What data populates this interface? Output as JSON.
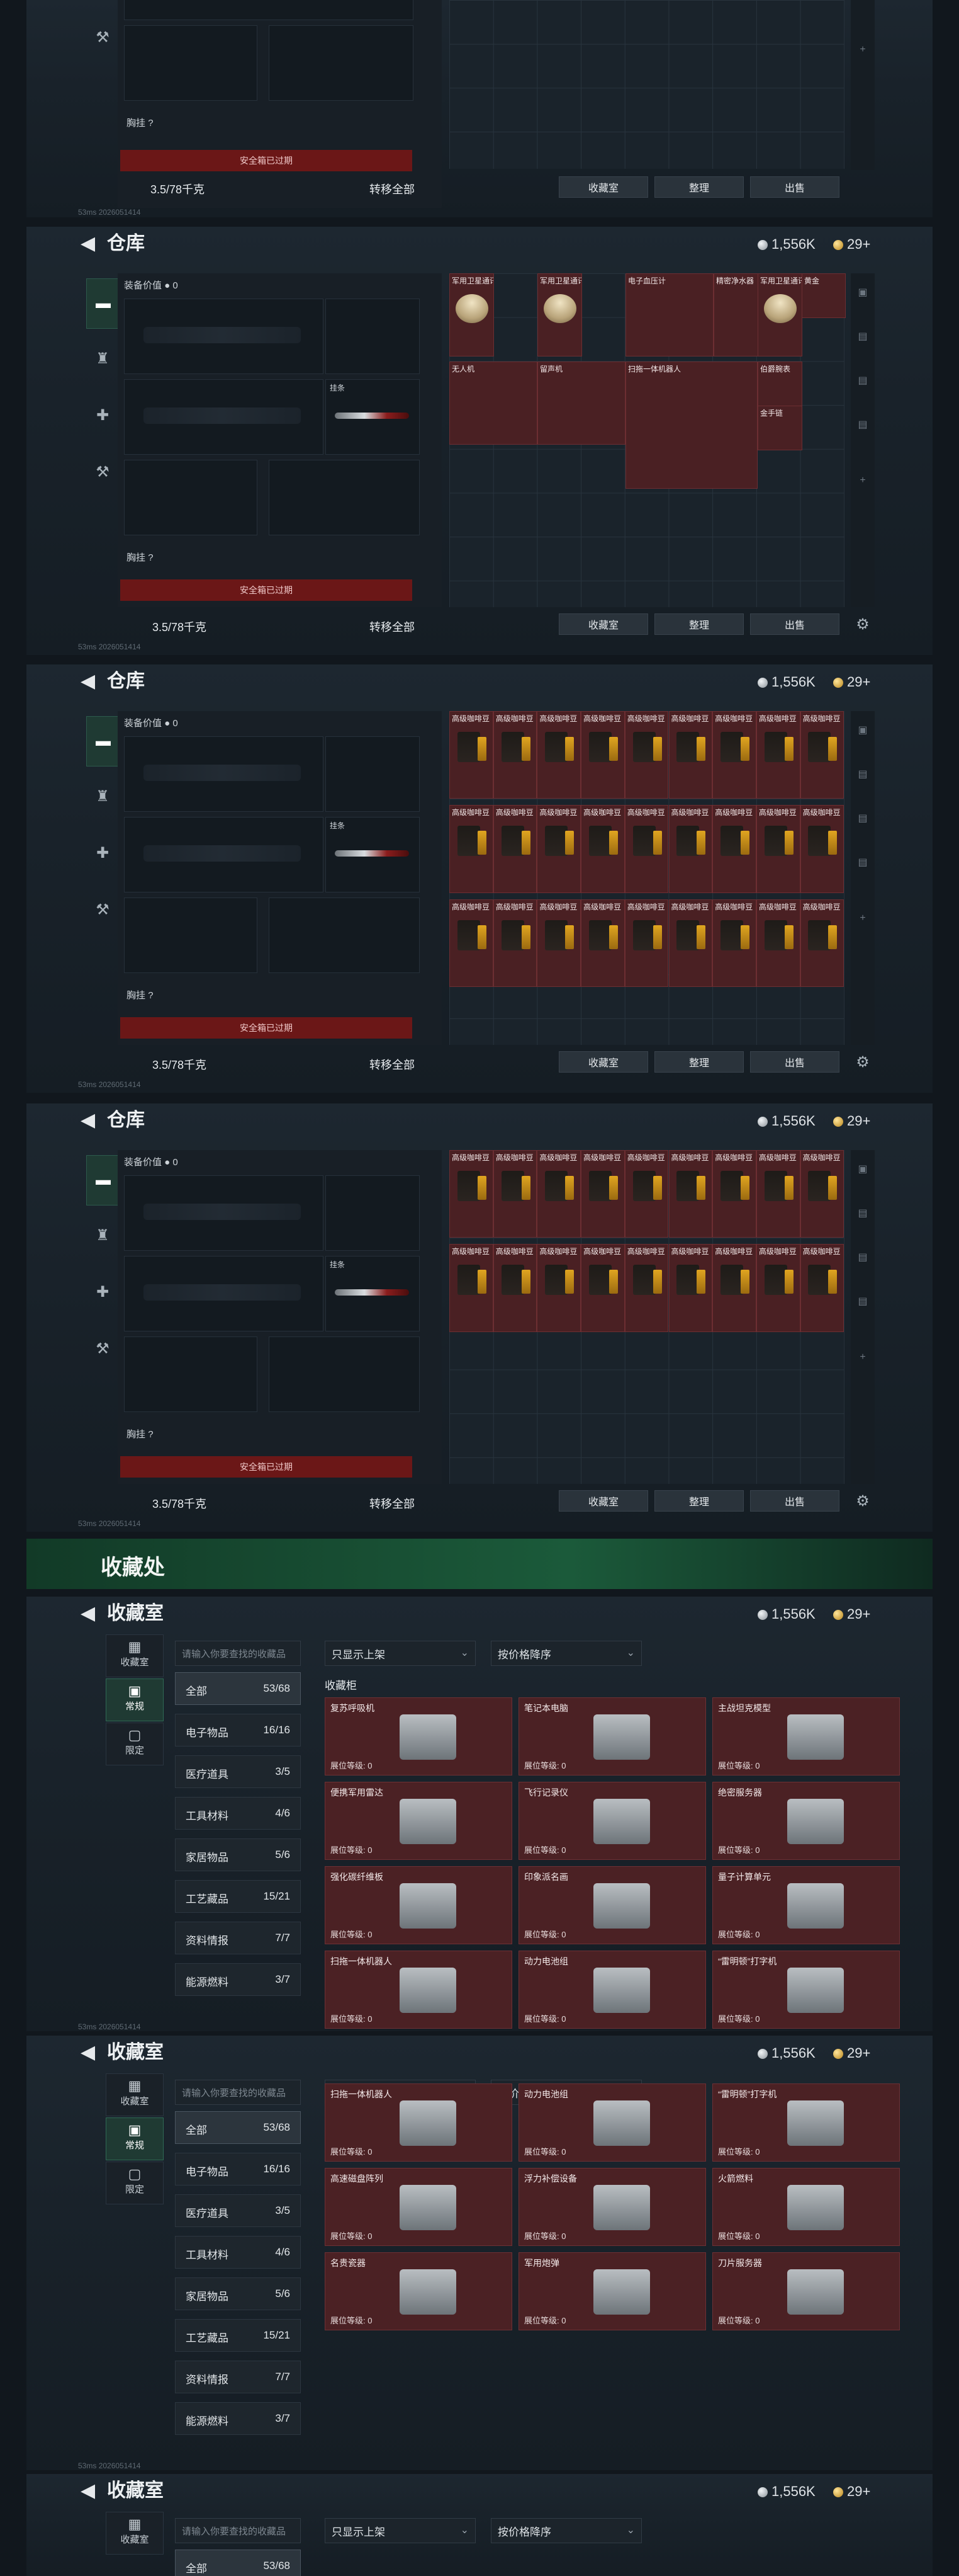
{
  "warehouse": {
    "title": "仓库",
    "equip_value_label": "装备价值",
    "equip_value": "0",
    "chest_label": "胸挂",
    "chest_q": "?",
    "expired_text": "安全箱已过期",
    "capacity": "3.5/78千克",
    "transfer_label": "转移全部",
    "sling_label": "挂条",
    "buttons": {
      "collection": "收藏室",
      "organize": "整理",
      "sell": "出售"
    },
    "currency_silver": "1,556K",
    "currency_gold": "29+",
    "status_ping": "53ms",
    "status_id": "2026051414"
  },
  "items_panel2": [
    "军用卫星通讯仪",
    "军用卫星通讯仪",
    "电子血压计",
    "精密净水器",
    "军用卫星通讯仪",
    "黄金",
    "无人机",
    "留声机",
    "扫拖一体机器人",
    "伯爵腕表",
    "金手链"
  ],
  "coffee_label": "高级咖啡豆",
  "collection_banner": "收藏处",
  "collection": {
    "title": "收藏室",
    "tabs": [
      "收藏室",
      "常规",
      "限定"
    ],
    "search_placeholder": "请输入你要查找的收藏品",
    "filter": "只显示上架",
    "sort": "按价格降序",
    "section": "收藏柜",
    "categories": [
      {
        "name": "全部",
        "count": "53/68"
      },
      {
        "name": "电子物品",
        "count": "16/16"
      },
      {
        "name": "医疗道具",
        "count": "3/5"
      },
      {
        "name": "工具材料",
        "count": "4/6"
      },
      {
        "name": "家居物品",
        "count": "5/6"
      },
      {
        "name": "工艺藏品",
        "count": "15/21"
      },
      {
        "name": "资料情报",
        "count": "7/7"
      },
      {
        "name": "能源燃料",
        "count": "3/7"
      }
    ],
    "level_label": "展位等级: 0",
    "cards_a": [
      "复苏呼吸机",
      "笔记本电脑",
      "主战坦克模型",
      "便携军用雷达",
      "飞行记录仪",
      "绝密服务器",
      "强化碳纤维板",
      "印象派名画",
      "量子计算单元",
      "扫拖一体机器人",
      "动力电池组",
      "“雷明顿”打字机"
    ],
    "cards_b": [
      "扫拖一体机器人",
      "动力电池组",
      "“雷明顿”打字机",
      "高速磁盘阵列",
      "浮力补偿设备",
      "火箭燃料",
      "名贵瓷器",
      "军用炮弹",
      "刀片服务器"
    ]
  }
}
